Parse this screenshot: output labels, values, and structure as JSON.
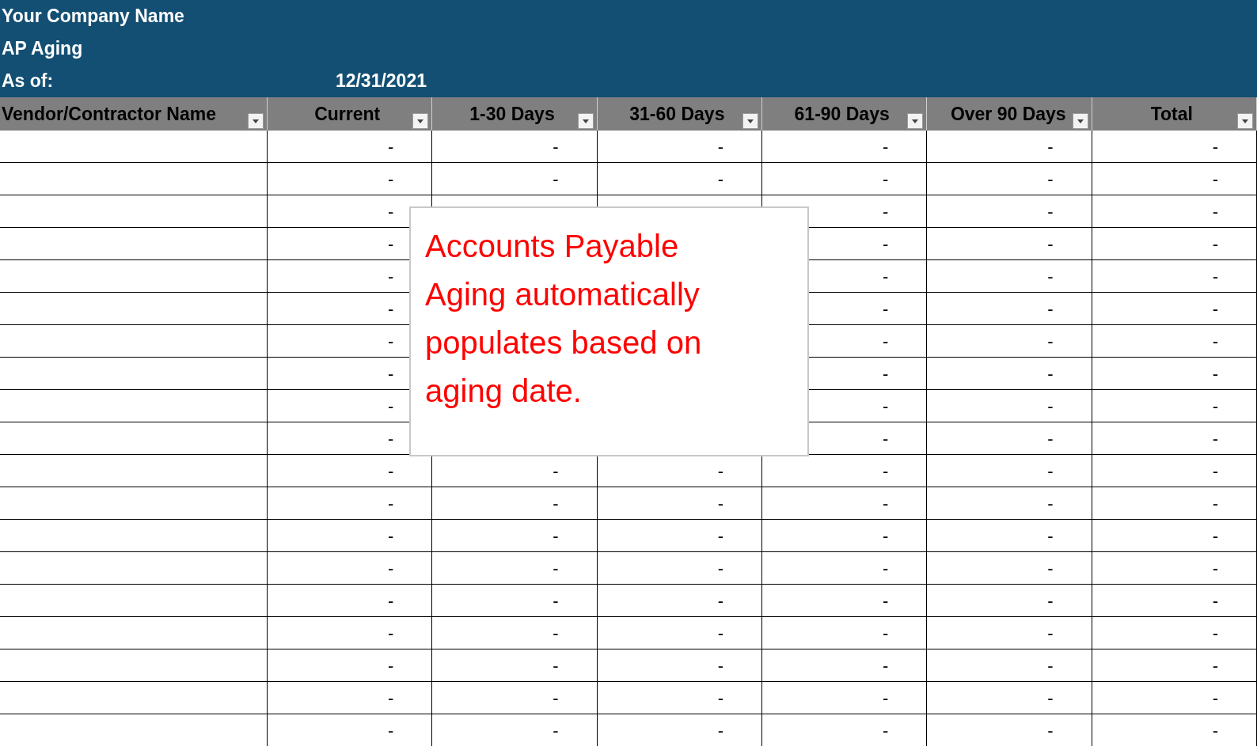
{
  "report": {
    "company": "Your Company Name",
    "title": "AP Aging",
    "as_of_label": "As of:",
    "as_of_date": "12/31/2021"
  },
  "table": {
    "columns": [
      "Vendor/Contractor Name",
      "Current",
      "1-30 Days",
      "31-60 Days",
      "61-90 Days",
      "Over 90 Days",
      "Total"
    ],
    "rows": [
      {
        "cells": [
          "",
          "-",
          "-",
          "-",
          "-",
          "-",
          "-"
        ]
      },
      {
        "cells": [
          "",
          "-",
          "-",
          "-",
          "-",
          "-",
          "-"
        ]
      },
      {
        "cells": [
          "",
          "-",
          null,
          null,
          "-",
          "-",
          "-"
        ]
      },
      {
        "cells": [
          "",
          "-",
          null,
          null,
          "-",
          "-",
          "-"
        ]
      },
      {
        "cells": [
          "",
          "-",
          null,
          null,
          "-",
          "-",
          "-"
        ]
      },
      {
        "cells": [
          "",
          "-",
          null,
          null,
          "-",
          "-",
          "-"
        ]
      },
      {
        "cells": [
          "",
          "-",
          null,
          null,
          "-",
          "-",
          "-"
        ]
      },
      {
        "cells": [
          "",
          "-",
          null,
          null,
          "-",
          "-",
          "-"
        ]
      },
      {
        "cells": [
          "",
          "-",
          null,
          null,
          "-",
          "-",
          "-"
        ]
      },
      {
        "cells": [
          "",
          "-",
          null,
          null,
          "-",
          "-",
          "-"
        ]
      },
      {
        "cells": [
          "",
          "-",
          "-",
          "-",
          "-",
          "-",
          "-"
        ]
      },
      {
        "cells": [
          "",
          "-",
          "-",
          "-",
          "-",
          "-",
          "-"
        ]
      },
      {
        "cells": [
          "",
          "-",
          "-",
          "-",
          "-",
          "-",
          "-"
        ]
      },
      {
        "cells": [
          "",
          "-",
          "-",
          "-",
          "-",
          "-",
          "-"
        ]
      },
      {
        "cells": [
          "",
          "-",
          "-",
          "-",
          "-",
          "-",
          "-"
        ]
      },
      {
        "cells": [
          "",
          "-",
          "-",
          "-",
          "-",
          "-",
          "-"
        ]
      },
      {
        "cells": [
          "",
          "-",
          "-",
          "-",
          "-",
          "-",
          "-"
        ]
      },
      {
        "cells": [
          "",
          "-",
          "-",
          "-",
          "-",
          "-",
          "-"
        ]
      },
      {
        "cells": [
          "",
          "-",
          "-",
          "-",
          "-",
          "-",
          "-"
        ]
      }
    ]
  },
  "note": {
    "text": "Accounts Payable Aging automatically populates based on aging date."
  }
}
